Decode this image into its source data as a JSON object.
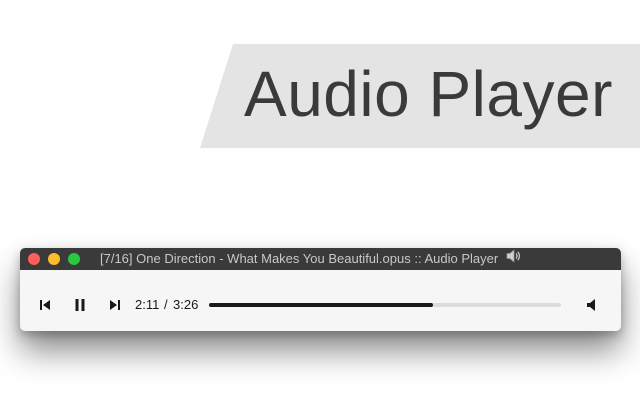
{
  "banner": {
    "title": "Audio Player"
  },
  "window": {
    "title": "[7/16] One Direction - What Makes You Beautiful.opus :: Audio Player",
    "title_icon": "speaker-icon"
  },
  "controls": {
    "previous_icon": "skip-previous-icon",
    "pause_icon": "pause-icon",
    "next_icon": "skip-next-icon",
    "volume_icon": "volume-icon"
  },
  "playback": {
    "current_time": "2:11",
    "separator": "/",
    "total_time": "3:26",
    "progress_fraction": 0.636
  },
  "colors": {
    "banner_bg": "#e4e4e4",
    "titlebar_bg": "#3a3a3a",
    "close": "#fc5f57",
    "minimize": "#fdbc2e",
    "maximize": "#28c840",
    "progress_fill": "#1a1a1a",
    "progress_track": "#dcdcdc"
  }
}
